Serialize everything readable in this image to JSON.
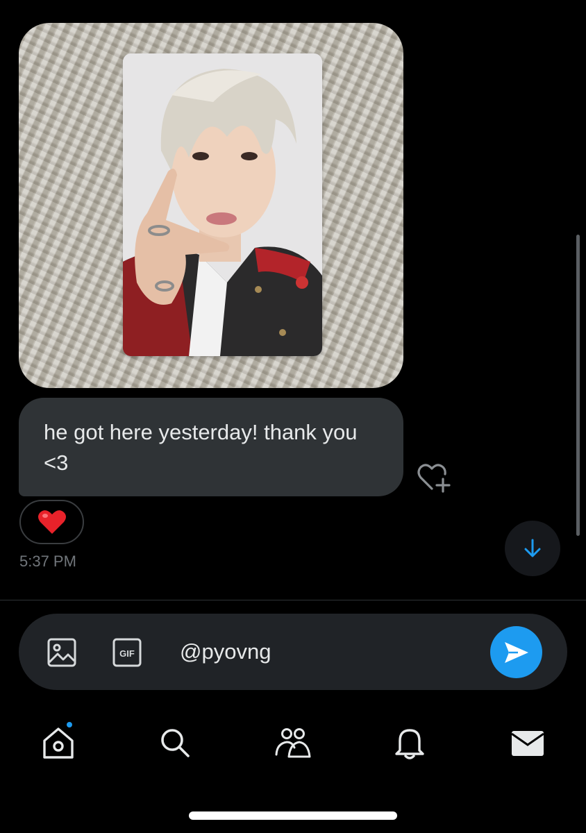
{
  "message": {
    "text": "he got here yesterday! thank you <3",
    "reaction_emoji": "❤️",
    "timestamp": "5:37 PM"
  },
  "icons": {
    "add_reaction": "heart-plus-icon",
    "scroll_down": "arrow-down-icon",
    "media": "image-icon",
    "gif": "gif-icon",
    "send": "send-icon"
  },
  "composer": {
    "value": "@pyovng",
    "gif_label": "GIF"
  },
  "nav": {
    "items": [
      {
        "name": "home",
        "icon": "home-icon",
        "has_badge": true
      },
      {
        "name": "search",
        "icon": "search-icon"
      },
      {
        "name": "communities",
        "icon": "communities-icon"
      },
      {
        "name": "notifications",
        "icon": "bell-icon"
      },
      {
        "name": "messages",
        "icon": "envelope-icon"
      }
    ]
  },
  "colors": {
    "accent": "#1d9bf0",
    "bubble": "#2f3336",
    "composer": "#202327",
    "timestamp": "#71767b"
  }
}
